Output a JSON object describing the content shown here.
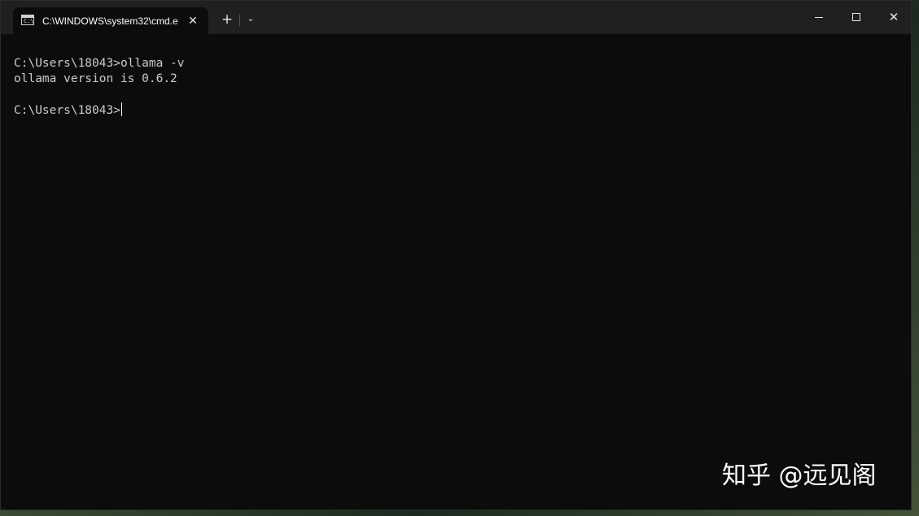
{
  "window": {
    "tab_title": "C:\\WINDOWS\\system32\\cmd.e",
    "tab_icon": "cmd-icon",
    "tab_icon_prompt": "C:\\",
    "close_tab_glyph": "✕",
    "new_tab_glyph": "+",
    "dropdown_glyph": "⌄",
    "close_window_glyph": "✕"
  },
  "terminal": {
    "lines": [
      "C:\\Users\\18043>ollama -v",
      "ollama version is 0.6.2",
      "C:\\Users\\18043>"
    ],
    "text_color": "#cccccc",
    "background": "#0c0c0c"
  },
  "watermark": {
    "text": "知乎 @远见阁"
  }
}
